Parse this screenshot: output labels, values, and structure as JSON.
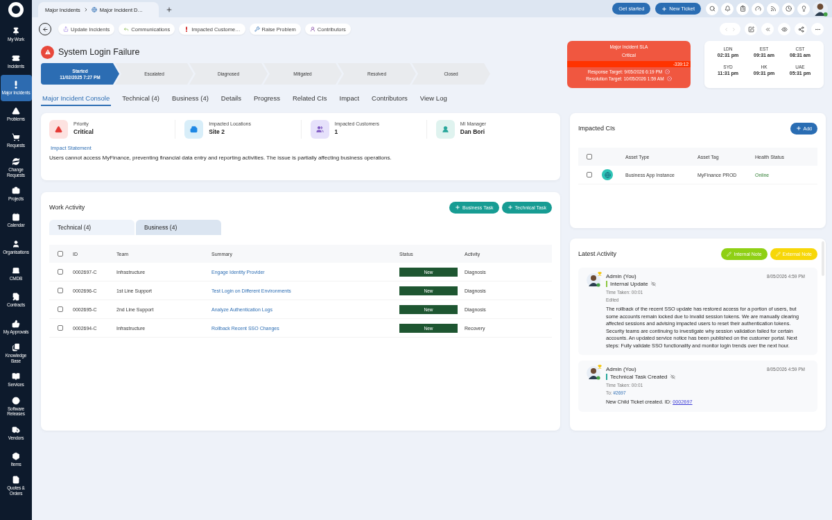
{
  "sidebar": {
    "items": [
      {
        "label": "My Work",
        "selected": false
      },
      {
        "label": "Incidents",
        "selected": false
      },
      {
        "label": "Major Incidents",
        "selected": true
      },
      {
        "label": "Problems",
        "selected": false
      },
      {
        "label": "Requests",
        "selected": false
      },
      {
        "label": "Change Requests",
        "selected": false
      },
      {
        "label": "Projects",
        "selected": false
      },
      {
        "label": "Calendar",
        "selected": false
      },
      {
        "label": "Organisations",
        "selected": false
      },
      {
        "label": "CMDB",
        "selected": false
      },
      {
        "label": "Contracts",
        "selected": false
      },
      {
        "label": "My Approvals",
        "selected": false
      },
      {
        "label": "Knowledge Base",
        "selected": false
      },
      {
        "label": "Services",
        "selected": false
      },
      {
        "label": "Software Releases",
        "selected": false
      },
      {
        "label": "Vendors",
        "selected": false
      },
      {
        "label": "Items",
        "selected": false
      },
      {
        "label": "Quotes & Orders",
        "selected": false
      }
    ]
  },
  "top_bar": {
    "breadcrumb": [
      "Major Incidents",
      "Major Incident D…"
    ],
    "get_started": "Get started",
    "new_ticket": "New Ticket"
  },
  "actions": [
    "Update Incidents",
    "Communications",
    "Impacted Custome…",
    "Raise Problem",
    "Contributors"
  ],
  "title": "System Login Failure",
  "stages": [
    {
      "label": "Started",
      "date": "11/02/2025 7:27 PM",
      "selected": true
    },
    {
      "label": "Escalated",
      "selected": false
    },
    {
      "label": "Diagnosed",
      "selected": false
    },
    {
      "label": "Mitigated",
      "selected": false
    },
    {
      "label": "Resolved",
      "selected": false
    },
    {
      "label": "Closed",
      "selected": false
    }
  ],
  "sla": {
    "title": "Major Incident SLA",
    "level_text": "Critical",
    "overdue": "-339:12",
    "targets": [
      "Response Target: 9/05/2026 6:19 PM",
      "Resolution Target: 10/05/2026 1:59 AM"
    ]
  },
  "time_zones": [
    {
      "city": "LDN",
      "time": "02:31 pm"
    },
    {
      "city": "EST",
      "time": "09:31 am"
    },
    {
      "city": "CST",
      "time": "08:31 am"
    },
    {
      "city": "SYD",
      "time": "11:31 pm"
    },
    {
      "city": "HK",
      "time": "09:31 pm"
    },
    {
      "city": "UAE",
      "time": "05:31 pm"
    }
  ],
  "tabs": [
    {
      "label": "Major Incident Console",
      "selected": true
    },
    {
      "label": "Technical (4)",
      "selected": false
    },
    {
      "label": "Business (4)",
      "selected": false
    },
    {
      "label": "Details",
      "selected": false
    },
    {
      "label": "Progress",
      "selected": false
    },
    {
      "label": "Related CIs",
      "selected": false
    },
    {
      "label": "Impact",
      "selected": false
    },
    {
      "label": "Contributors",
      "selected": false
    },
    {
      "label": "View Log",
      "selected": false
    }
  ],
  "summary": {
    "stats": [
      {
        "label": "Priority",
        "value": "Critical"
      },
      {
        "label": "Impacted Locations",
        "value": "Site 2"
      },
      {
        "label": "Impacted Customers",
        "value": "1"
      },
      {
        "label": "MI Manager",
        "value": "Dan Bori"
      }
    ],
    "impact_label": "Impact Statement",
    "impact_text": "Users cannot access MyFinance, preventing financial data entry and reporting activities. The issue is partially affecting business operations."
  },
  "work_activity": {
    "title": "Work Activity",
    "buttons": [
      "Business Task",
      "Technical Task"
    ],
    "tabs": [
      {
        "label": "Technical (4)",
        "selected": true
      },
      {
        "label": "Business (4)",
        "selected": false
      }
    ],
    "select_all_checked": false,
    "columns": [
      "ID",
      "Team",
      "Summary",
      "Status",
      "Activity"
    ],
    "rows": [
      {
        "checked": false,
        "id": "0002697-C",
        "team": "Infrastructure",
        "summary": "Engage Identity Provider",
        "status": "New",
        "activity": "Diagnosis"
      },
      {
        "checked": false,
        "id": "0002696-C",
        "team": "1st Line Support",
        "summary": "Test Login on Different Environments",
        "status": "New",
        "activity": "Diagnosis"
      },
      {
        "checked": false,
        "id": "0002695-C",
        "team": "2nd Line Support",
        "summary": "Analyze Authentication Logs",
        "status": "New",
        "activity": "Diagnosis"
      },
      {
        "checked": false,
        "id": "0002694-C",
        "team": "Infrastructure",
        "summary": "Rollback Recent SSO Changes",
        "status": "New",
        "activity": "Recovery"
      }
    ]
  },
  "impacted_cis": {
    "title": "Impacted CIs",
    "add": "Add",
    "select_all_checked": false,
    "columns": [
      "Asset Type",
      "Asset Tag",
      "Health Status"
    ],
    "rows": [
      {
        "checked": false,
        "asset_type": "Business App Instance",
        "asset_tag": "MyFinance PROD",
        "health": "Online"
      }
    ]
  },
  "latest_activity": {
    "title": "Latest Activity",
    "buttons": [
      "Internal Note",
      "External Note"
    ],
    "entries": [
      {
        "author": "Admin (You)",
        "type": "Internal Update",
        "color": "#8cc63f",
        "time": "8/05/2026 4:59 PM",
        "meta": [
          {
            "text": "Time Taken: 00:01"
          },
          {
            "text": "Edited"
          }
        ],
        "body": "The rollback of the recent SSO update has restored access for a portion of users, but some accounts remain locked due to invalid session tokens. We are manually clearing affected sessions and advising impacted users to reset their authentication tokens. Security teams are continuing to investigate why session validation failed for certain accounts. An updated service notice has been published on the customer portal. Next steps: Fully validate SSO functionality and monitor login trends over the next hour."
      },
      {
        "author": "Admin (You)",
        "type": "Technical Task Created",
        "color": "#26a69a",
        "time": "8/05/2026 4:59 PM",
        "meta": [
          {
            "text": "Time Taken: 00:01"
          },
          {
            "text": "To:",
            "link": "#2697"
          }
        ],
        "body": "New Child Ticket created. ID:",
        "body_link": "0002697"
      }
    ]
  }
}
